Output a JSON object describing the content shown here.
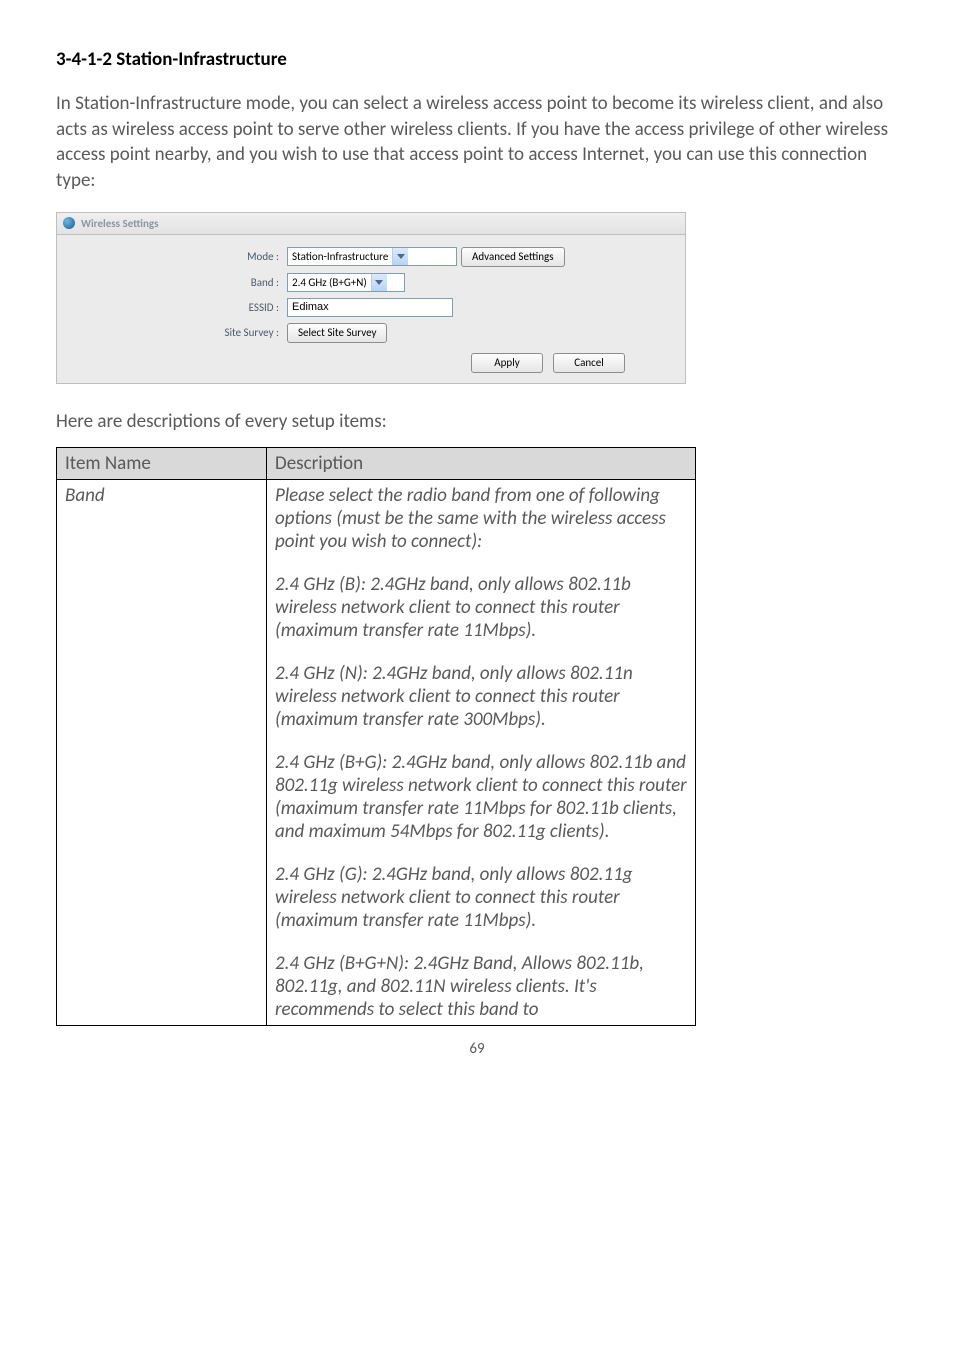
{
  "heading": "3-4-1-2 Station-Infrastructure",
  "intro": "In Station-Infrastructure mode, you can select a wireless access point to become its wireless client, and also acts as wireless access point to serve other wireless clients. If you have the access privilege of other wireless access point nearby, and you wish to use that access point to access Internet, you can use this connection type:",
  "panel": {
    "title": "Wireless Settings",
    "mode_label": "Mode :",
    "mode_value": "Station-Infrastructure",
    "adv_btn": "Advanced Settings",
    "band_label": "Band :",
    "band_value": "2.4 GHz (B+G+N)",
    "essid_label": "ESSID :",
    "essid_value": "Edimax",
    "survey_label": "Site Survey :",
    "survey_btn": "Select Site Survey",
    "apply": "Apply",
    "cancel": "Cancel"
  },
  "desc_line": "Here are descriptions of every setup items:",
  "table": {
    "h1": "Item Name",
    "h2": "Description",
    "row_name": "Band",
    "blocks": [
      "Please select the radio band from one of following options (must be the same with the wireless access point you wish to connect):",
      "2.4 GHz (B): 2.4GHz band, only allows 802.11b wireless network client to connect this router (maximum transfer rate 11Mbps).",
      "2.4 GHz (N): 2.4GHz band, only allows 802.11n wireless network client to connect this router (maximum transfer rate 300Mbps).",
      "2.4 GHz (B+G):    2.4GHz band, only allows 802.11b and 802.11g wireless network client to connect this router (maximum transfer rate 11Mbps for 802.11b clients, and maximum 54Mbps for 802.11g clients).",
      "2.4 GHz (G): 2.4GHz band, only allows 802.11g wireless network client to connect this router (maximum transfer rate 11Mbps).",
      "2.4 GHz (B+G+N): 2.4GHz Band, Allows 802.11b, 802.11g, and 802.11N wireless clients. It's recommends to select this band to"
    ]
  },
  "pagenum": "69"
}
